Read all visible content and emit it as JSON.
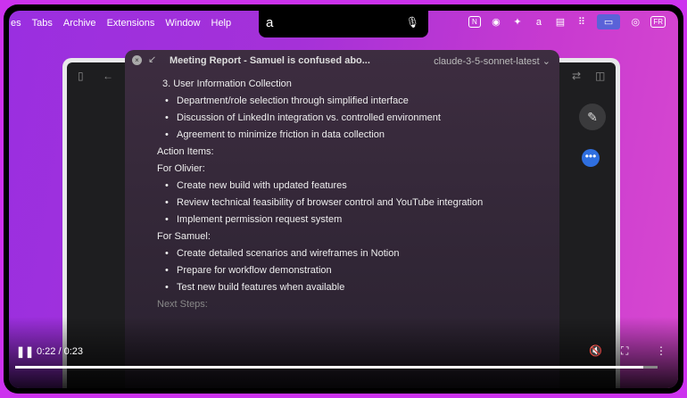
{
  "menubar": {
    "items": [
      "es",
      "Tabs",
      "Archive",
      "Extensions",
      "Window",
      "Help"
    ],
    "notch_logo": "a",
    "tray": [
      "N",
      "◉",
      "✦",
      "a",
      "▤",
      "⠿",
      "▭",
      "◎",
      "FR"
    ]
  },
  "dialog": {
    "title": "Meeting Report - Samuel is confused abo...",
    "model": "claude-3-5-sonnet-latest ⌄",
    "heading3": "3.  User Information Collection",
    "list1": [
      "Department/role selection through simplified interface",
      "Discussion of LinkedIn integration vs. controlled environment",
      "Agreement to minimize friction in data collection"
    ],
    "action_items": "Action Items:",
    "for_olivier": "For Olivier:",
    "list2": [
      "Create new build with updated features",
      "Review technical feasibility of browser control and YouTube integration",
      "Implement permission request system"
    ],
    "for_samuel": "For Samuel:",
    "list3": [
      "Create detailed scenarios and wireframes in Notion",
      "Prepare for workflow demonstration",
      "Test new build features when available"
    ],
    "next_steps": "Next Steps:"
  },
  "video": {
    "time": "0:22 / 0:23",
    "progress": 0.978,
    "play_icon": "pause-icon"
  }
}
